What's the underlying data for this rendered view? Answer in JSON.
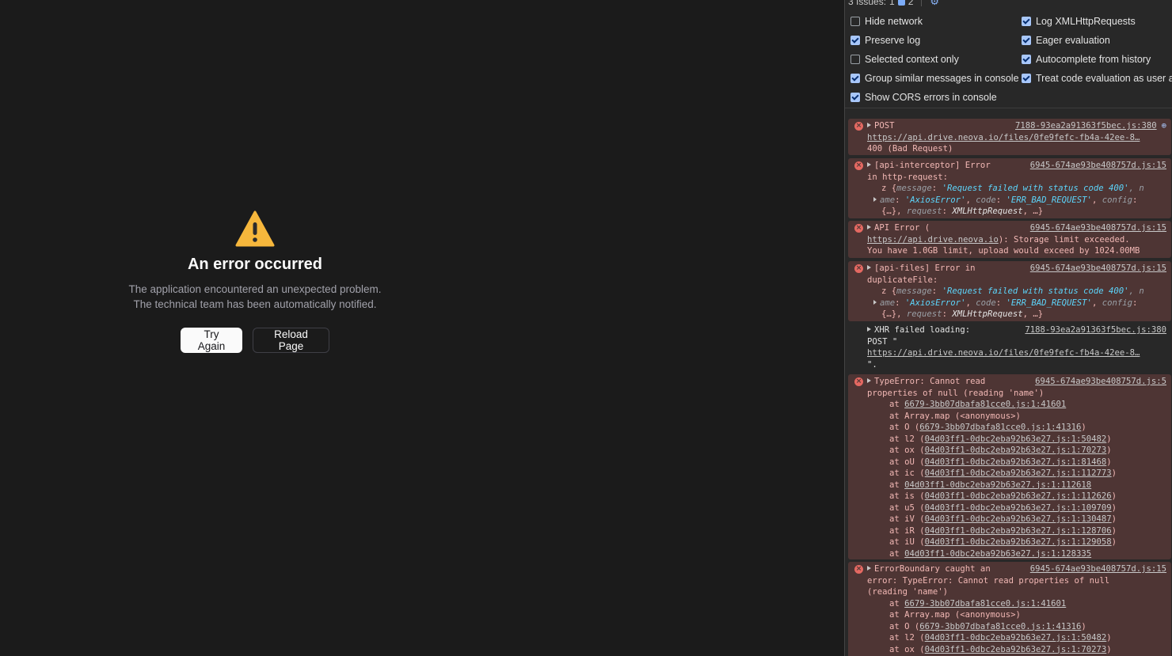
{
  "app": {
    "error_title": "An error occurred",
    "error_message": "The application encountered an unexpected problem. The technical team has been automatically notified.",
    "try_again_label": "Try Again",
    "reload_label": "Reload Page"
  },
  "devtools": {
    "issues_label": "3 Issues:",
    "error_issue_count": "1",
    "info_issue_count": "2",
    "settings": [
      {
        "label": "Hide network",
        "checked": false
      },
      {
        "label": "Log XMLHttpRequests",
        "checked": true
      },
      {
        "label": "Preserve log",
        "checked": true
      },
      {
        "label": "Eager evaluation",
        "checked": true
      },
      {
        "label": "Selected context only",
        "checked": false
      },
      {
        "label": "Autocomplete from history",
        "checked": true
      },
      {
        "label": "Group similar messages in console",
        "checked": true
      },
      {
        "label": "Treat code evaluation as user acti",
        "checked": true
      },
      {
        "label": "Show CORS errors in console",
        "checked": true
      }
    ],
    "messages": {
      "m1": {
        "text": "POST",
        "source": "7188-93ea2a91363f5bec.js:380",
        "url": "https://api.drive.neova.io/files/0fe9fefc-fb4a-42ee-8…",
        "status": "400 (Bad Request)"
      },
      "m2": {
        "text": "[api-interceptor] Error",
        "source": "6945-674ae93be408757d.js:15",
        "line2": "in http-request:",
        "obj_prefix": "z {",
        "k_message": "message",
        "v_message": "'Request failed with status code 400'",
        "tail1": ", n",
        "k_name": "ame",
        "v_name": "'AxiosError'",
        "k_code": "code",
        "v_code": "'ERR_BAD_REQUEST'",
        "k_config": "config",
        "obj_more": "{…}",
        "k_request": "request",
        "v_request": "XMLHttpRequest",
        "obj_end": "…}"
      },
      "m3": {
        "text": "API Error (",
        "source": "6945-674ae93be408757d.js:15",
        "link": "https://api.drive.neova.io",
        "after_link": "): Storage limit exceeded.",
        "line3": "You have 1.0GB limit, upload would exceed by 1024.00MB"
      },
      "m4": {
        "text": "[api-files] Error in",
        "source": "6945-674ae93be408757d.js:15",
        "line2": "duplicateFile:"
      },
      "m5": {
        "text": "XHR failed loading:",
        "source": "7188-93ea2a91363f5bec.js:380",
        "line2": "POST \"",
        "url": "https://api.drive.neova.io/files/0fe9fefc-fb4a-42ee-8…",
        "line4": "\"."
      },
      "m6": {
        "text": "TypeError: Cannot read",
        "source": "6945-674ae93be408757d.js:5",
        "line2": "properties of null (reading 'name')",
        "stack": [
          {
            "prefix": "at ",
            "fn": "",
            "link": "6679-3bb07dbafa81cce0.js:1:41601",
            "suffix": ""
          },
          {
            "prefix": "at Array.map (<anonymous>)",
            "fn": "",
            "link": "",
            "suffix": ""
          },
          {
            "prefix": "at O (",
            "fn": "",
            "link": "6679-3bb07dbafa81cce0.js:1:41316",
            "suffix": ")"
          },
          {
            "prefix": "at l2 (",
            "fn": "",
            "link": "04d03ff1-0dbc2eba92b63e27.js:1:50482",
            "suffix": ")"
          },
          {
            "prefix": "at ox (",
            "fn": "",
            "link": "04d03ff1-0dbc2eba92b63e27.js:1:70273",
            "suffix": ")"
          },
          {
            "prefix": "at oU (",
            "fn": "",
            "link": "04d03ff1-0dbc2eba92b63e27.js:1:81468",
            "suffix": ")"
          },
          {
            "prefix": "at ic (",
            "fn": "",
            "link": "04d03ff1-0dbc2eba92b63e27.js:1:112773",
            "suffix": ")"
          },
          {
            "prefix": "at ",
            "fn": "",
            "link": "04d03ff1-0dbc2eba92b63e27.js:1:112618",
            "suffix": ""
          },
          {
            "prefix": "at is (",
            "fn": "",
            "link": "04d03ff1-0dbc2eba92b63e27.js:1:112626",
            "suffix": ")"
          },
          {
            "prefix": "at u5 (",
            "fn": "",
            "link": "04d03ff1-0dbc2eba92b63e27.js:1:109709",
            "suffix": ")"
          },
          {
            "prefix": "at iV (",
            "fn": "",
            "link": "04d03ff1-0dbc2eba92b63e27.js:1:130487",
            "suffix": ")"
          },
          {
            "prefix": "at iR (",
            "fn": "",
            "link": "04d03ff1-0dbc2eba92b63e27.js:1:128706",
            "suffix": ")"
          },
          {
            "prefix": "at iU (",
            "fn": "",
            "link": "04d03ff1-0dbc2eba92b63e27.js:1:129058",
            "suffix": ")"
          },
          {
            "prefix": "at ",
            "fn": "",
            "link": "04d03ff1-0dbc2eba92b63e27.js:1:128335",
            "suffix": ""
          }
        ]
      },
      "m7": {
        "text": "ErrorBoundary caught an",
        "source": "6945-674ae93be408757d.js:15",
        "line2": "error: TypeError: Cannot read properties of null",
        "line3": "(reading 'name')",
        "stack": [
          {
            "prefix": "at ",
            "link": "6679-3bb07dbafa81cce0.js:1:41601",
            "suffix": ""
          },
          {
            "prefix": "at Array.map (<anonymous>)",
            "link": "",
            "suffix": ""
          },
          {
            "prefix": "at O (",
            "link": "6679-3bb07dbafa81cce0.js:1:41316",
            "suffix": ")"
          },
          {
            "prefix": "at l2 (",
            "link": "04d03ff1-0dbc2eba92b63e27.js:1:50482",
            "suffix": ")"
          },
          {
            "prefix": "at ox (",
            "link": "04d03ff1-0dbc2eba92b63e27.js:1:70273",
            "suffix": ")"
          }
        ]
      }
    },
    "colors": {
      "error_bg": "#4e3534",
      "error_text": "#f2b8b5",
      "checkbox_on": "#a8c7fa"
    }
  }
}
